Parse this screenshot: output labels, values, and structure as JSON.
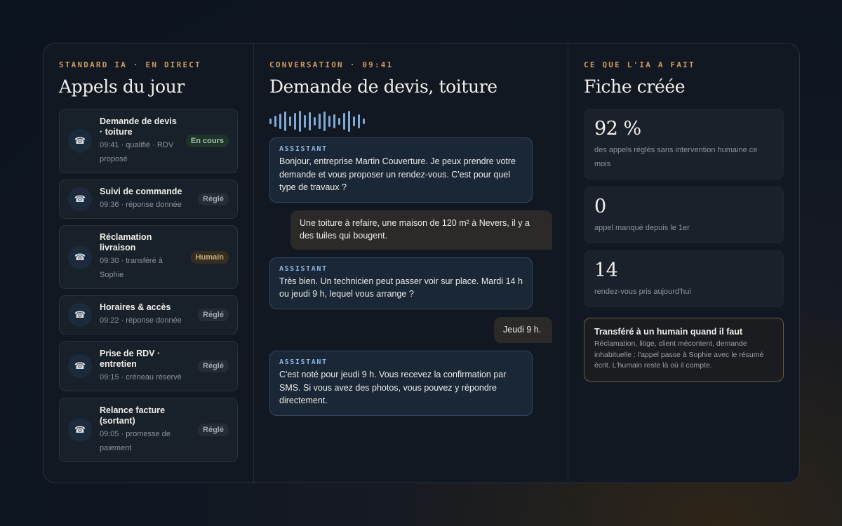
{
  "left": {
    "eyebrow": "STANDARD IA · EN DIRECT",
    "title": "Appels du jour",
    "calls": [
      {
        "title": "Demande de devis · toiture",
        "sub": "09:41 · qualifié · RDV proposé",
        "badge": "En cours",
        "status": "live"
      },
      {
        "title": "Suivi de commande",
        "sub": "09:36 · réponse donnée",
        "badge": "Réglé",
        "status": "done"
      },
      {
        "title": "Réclamation livraison",
        "sub": "09:30 · transféré à Sophie",
        "badge": "Humain",
        "status": "human"
      },
      {
        "title": "Horaires & accès",
        "sub": "09:22 · réponse donnée",
        "badge": "Réglé",
        "status": "done"
      },
      {
        "title": "Prise de RDV · entretien",
        "sub": "09:15 · créneau réservé",
        "badge": "Réglé",
        "status": "done"
      },
      {
        "title": "Relance facture (sortant)",
        "sub": "09:05 · promesse de paiement",
        "badge": "Réglé",
        "status": "done"
      }
    ],
    "call_icon": "phone-icon"
  },
  "middle": {
    "eyebrow": "CONVERSATION · 09:41",
    "title": "Demande de devis, toiture",
    "waveform_icon": "audio-waveform",
    "messages": [
      {
        "role": "assistant",
        "label": "ASSISTANT",
        "text": "Bonjour, entreprise Martin Couverture. Je peux prendre votre demande et vous proposer un rendez-vous. C'est pour quel type de travaux ?"
      },
      {
        "role": "user",
        "text": "Une toiture à refaire, une maison de 120 m² à Nevers, il y a des tuiles qui bougent."
      },
      {
        "role": "assistant",
        "label": "ASSISTANT",
        "text": "Très bien. Un technicien peut passer voir sur place. Mardi 14 h ou jeudi 9 h, lequel vous arrange ?"
      },
      {
        "role": "user",
        "text": "Jeudi 9 h."
      },
      {
        "role": "assistant",
        "label": "ASSISTANT",
        "text": "C'est noté pour jeudi 9 h. Vous recevez la confirmation par SMS. Si vous avez des photos, vous pouvez y répondre directement."
      }
    ]
  },
  "right": {
    "eyebrow": "CE QUE L'IA A FAIT",
    "title": "Fiche créée",
    "stats": [
      {
        "value": "92 %",
        "label": "des appels réglés sans intervention humaine ce mois"
      },
      {
        "value": "0",
        "label": "appel manqué depuis le 1er"
      },
      {
        "value": "14",
        "label": "rendez-vous pris aujourd'hui"
      }
    ],
    "note": {
      "title": "Transféré à un humain quand il faut",
      "text": "Réclamation, litige, client mécontent, demande inhabituelle : l'appel passe à Sophie avec le résumé écrit. L'humain reste là où il compte."
    }
  },
  "colors": {
    "accent": "#c89b62",
    "assistant_label": "#8fb6e4",
    "waveform": "#7fa8d6",
    "badge_live": "#9cc3a7",
    "badge_human": "#c0a880"
  }
}
